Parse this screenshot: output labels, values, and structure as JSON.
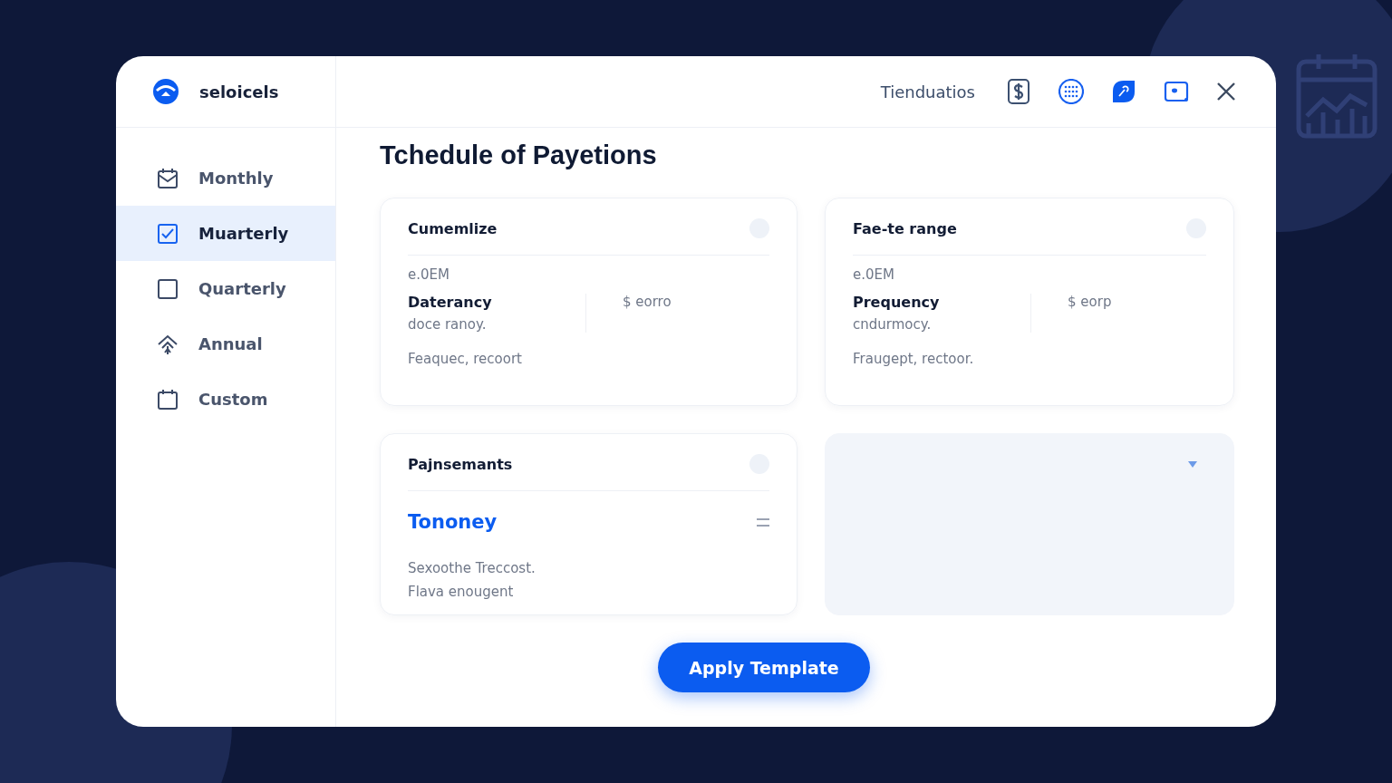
{
  "brand": {
    "name": "seloicels"
  },
  "header": {
    "link": "Tienduatios",
    "tools": [
      {
        "kind": "dollar"
      },
      {
        "kind": "dots"
      },
      {
        "kind": "leaf"
      },
      {
        "kind": "screen"
      }
    ]
  },
  "sidebar": {
    "items": [
      {
        "label": "Monthly",
        "kind": "calendar-check",
        "selected": false
      },
      {
        "label": "Muarterly",
        "kind": "checkbox",
        "selected": true
      },
      {
        "label": "Quarterly",
        "kind": "grid",
        "selected": false
      },
      {
        "label": "Annual",
        "kind": "arrows",
        "selected": false
      },
      {
        "label": "Custom",
        "kind": "calendar-grid",
        "selected": false
      }
    ]
  },
  "title": "Tchedule of Payetions",
  "cards": [
    {
      "kind": "detail",
      "title": "Cumemlize",
      "code": "e.0EM",
      "label": "Daterancy",
      "amount": "$ eorro",
      "sub": "doce ranoy.",
      "note": "Feaquec, recoort"
    },
    {
      "kind": "detail",
      "title": "Fae-te range",
      "code": "e.0EM",
      "label": "Prequency",
      "amount": "$ eorp",
      "sub": "cndurmocy.",
      "note": "Fraugept, rectoor."
    },
    {
      "kind": "amount",
      "title": "Pajnsemants",
      "value": "Tononey",
      "lines": [
        "Sexoothe Treccost.",
        "Flava enougent"
      ]
    },
    {
      "kind": "empty"
    }
  ],
  "button": "Apply Template"
}
